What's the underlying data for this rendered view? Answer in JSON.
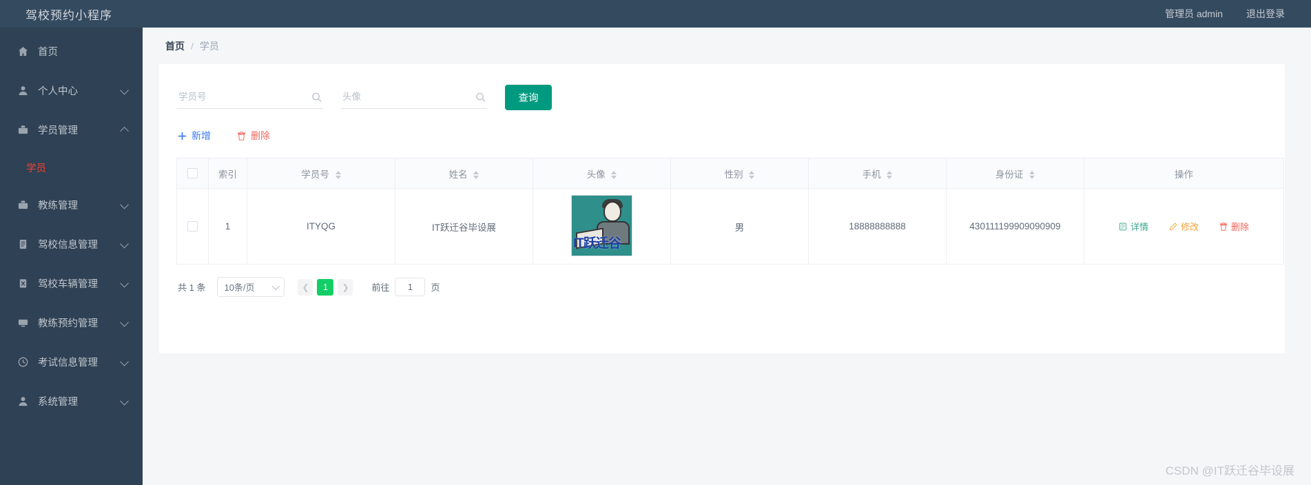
{
  "header": {
    "brand": "驾校预约小程序",
    "user_label": "管理员 admin",
    "logout_label": "退出登录"
  },
  "sidebar": {
    "items": [
      {
        "label": "首页",
        "icon": "home-icon",
        "expandable": false,
        "expanded": false
      },
      {
        "label": "个人中心",
        "icon": "user-icon",
        "expandable": true,
        "expanded": false
      },
      {
        "label": "学员管理",
        "icon": "briefcase-icon",
        "expandable": true,
        "expanded": true
      },
      {
        "label": "教练管理",
        "icon": "suitcase-icon",
        "expandable": true,
        "expanded": false
      },
      {
        "label": "驾校信息管理",
        "icon": "document-icon",
        "expandable": true,
        "expanded": false
      },
      {
        "label": "驾校车辆管理",
        "icon": "clipboard-icon",
        "expandable": true,
        "expanded": false
      },
      {
        "label": "教练预约管理",
        "icon": "monitor-icon",
        "expandable": true,
        "expanded": false
      },
      {
        "label": "考试信息管理",
        "icon": "clock-icon",
        "expandable": true,
        "expanded": false
      },
      {
        "label": "系统管理",
        "icon": "person-icon",
        "expandable": true,
        "expanded": false
      }
    ],
    "submenu": {
      "label": "学员",
      "active": true
    }
  },
  "breadcrumb": {
    "root": "首页",
    "separator": "/",
    "current": "学员"
  },
  "search": {
    "fields": [
      {
        "name": "student-no",
        "placeholder": "学员号",
        "value": "",
        "icon": "search-icon"
      },
      {
        "name": "avatar",
        "placeholder": "头像",
        "value": "",
        "icon": "search-icon"
      }
    ],
    "query_label": "查询"
  },
  "toolbar": {
    "add_label": "新增",
    "add_icon": "plus-icon",
    "delete_label": "删除",
    "delete_icon": "trash-icon"
  },
  "table": {
    "columns": [
      {
        "label": "",
        "name": "select-all",
        "sortable": false
      },
      {
        "label": "索引",
        "name": "index",
        "sortable": false
      },
      {
        "label": "学员号",
        "name": "student-no",
        "sortable": true
      },
      {
        "label": "姓名",
        "name": "name",
        "sortable": true
      },
      {
        "label": "头像",
        "name": "avatar",
        "sortable": true
      },
      {
        "label": "性别",
        "name": "gender",
        "sortable": true
      },
      {
        "label": "手机",
        "name": "phone",
        "sortable": true
      },
      {
        "label": "身份证",
        "name": "id-card",
        "sortable": true
      },
      {
        "label": "操作",
        "name": "operations",
        "sortable": false
      }
    ],
    "rows": [
      {
        "index": "1",
        "student_no": "ITYQG",
        "name": "IT跃迁谷毕设展",
        "avatar_alt": "IT跃迁谷",
        "gender": "男",
        "phone": "18888888888",
        "id_card": "430111199909090909"
      }
    ],
    "row_actions": [
      {
        "label": "详情",
        "name": "detail",
        "icon": "list-icon",
        "color": "#3aa88c"
      },
      {
        "label": "修改",
        "name": "edit",
        "icon": "pencil-icon",
        "color": "#f0a33a"
      },
      {
        "label": "删除",
        "name": "remove",
        "icon": "trash-icon",
        "color": "#f0665c"
      }
    ]
  },
  "pagination": {
    "total_text": "共 1 条",
    "page_size_label": "10条/页",
    "prev_icon": "chevron-left-icon",
    "next_icon": "chevron-right-icon",
    "current_page": "1",
    "goto_label": "前往",
    "goto_value": "1",
    "page_unit": "页"
  },
  "watermark": "CSDN @IT跃迁谷毕设展",
  "colors": {
    "sidebar_bg": "#2f4154",
    "topbar_bg": "#344a5f",
    "primary": "#009a80",
    "active_page": "#13ce66",
    "submenu_active": "#f04134"
  }
}
